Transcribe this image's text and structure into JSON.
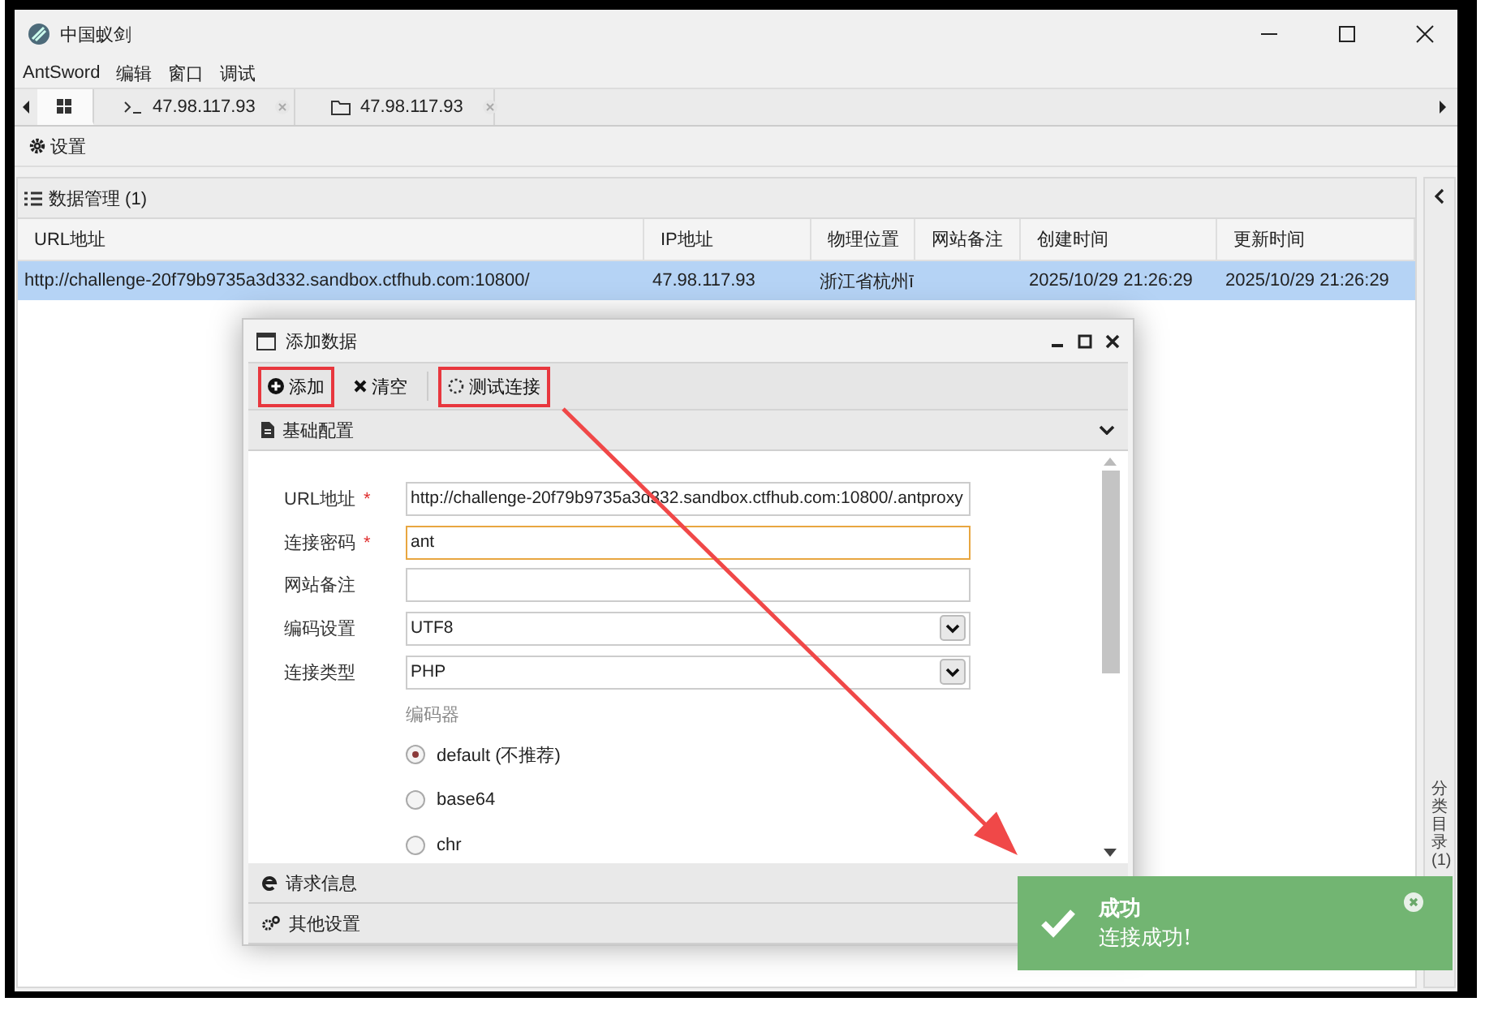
{
  "window": {
    "title": "中国蚁剑"
  },
  "menu": [
    "AntSword",
    "编辑",
    "窗口",
    "调试"
  ],
  "tabs": [
    {
      "kind": "home",
      "selected": true
    },
    {
      "kind": "terminal",
      "label": "47.98.117.93",
      "selected": false
    },
    {
      "kind": "folder",
      "label": "47.98.117.93",
      "selected": false
    }
  ],
  "toolbar": {
    "settings": "设置"
  },
  "data_panel": {
    "title": "数据管理 (1)",
    "columns": [
      "URL地址",
      "IP地址",
      "物理位置",
      "网站备注",
      "创建时间",
      "更新时间"
    ],
    "rows": [
      {
        "selected": true,
        "cells": [
          "http://challenge-20f79b9735a3d332.sandbox.ctfhub.com:10800/",
          "47.98.117.93",
          "浙江省杭州ī",
          "",
          "2025/10/29 21:26:29",
          "2025/10/29 21:26:29"
        ]
      }
    ]
  },
  "sidebar": {
    "title": "分类目录 (1)"
  },
  "dialog": {
    "title": "添加数据",
    "buttons": [
      {
        "kind": "add",
        "label": "添加",
        "highlighted": true
      },
      {
        "kind": "clear",
        "label": "清空",
        "highlighted": false
      },
      {
        "kind": "test",
        "label": "测试连接",
        "highlighted": true
      }
    ],
    "sections": [
      {
        "kind": "basic",
        "title": "基础配置",
        "expanded": true
      },
      {
        "kind": "request",
        "title": "请求信息",
        "expanded": false
      },
      {
        "kind": "other",
        "title": "其他设置",
        "expanded": false
      }
    ],
    "fields": [
      {
        "label": "URL地址",
        "required_mark": "*",
        "kind": "text",
        "value": "http://challenge-20f79b9735a3d332.sandbox.ctfhub.com:10800/.antproxy",
        "focused": false
      },
      {
        "label": "连接密码",
        "required_mark": "*",
        "kind": "text",
        "value": "ant",
        "focused": true
      },
      {
        "label": "网站备注",
        "kind": "text",
        "focused": false
      },
      {
        "label": "编码设置",
        "kind": "select",
        "value": "UTF8",
        "focused": false
      },
      {
        "label": "连接类型",
        "kind": "select",
        "value": "PHP",
        "focused": false
      }
    ],
    "encoder": {
      "label": "编码器",
      "options": [
        {
          "label": "default (不推荐)",
          "selected": true
        },
        {
          "label": "base64",
          "selected": false
        },
        {
          "label": "chr",
          "selected": false
        }
      ]
    }
  },
  "toast": {
    "title": "成功",
    "message": "连接成功!"
  }
}
